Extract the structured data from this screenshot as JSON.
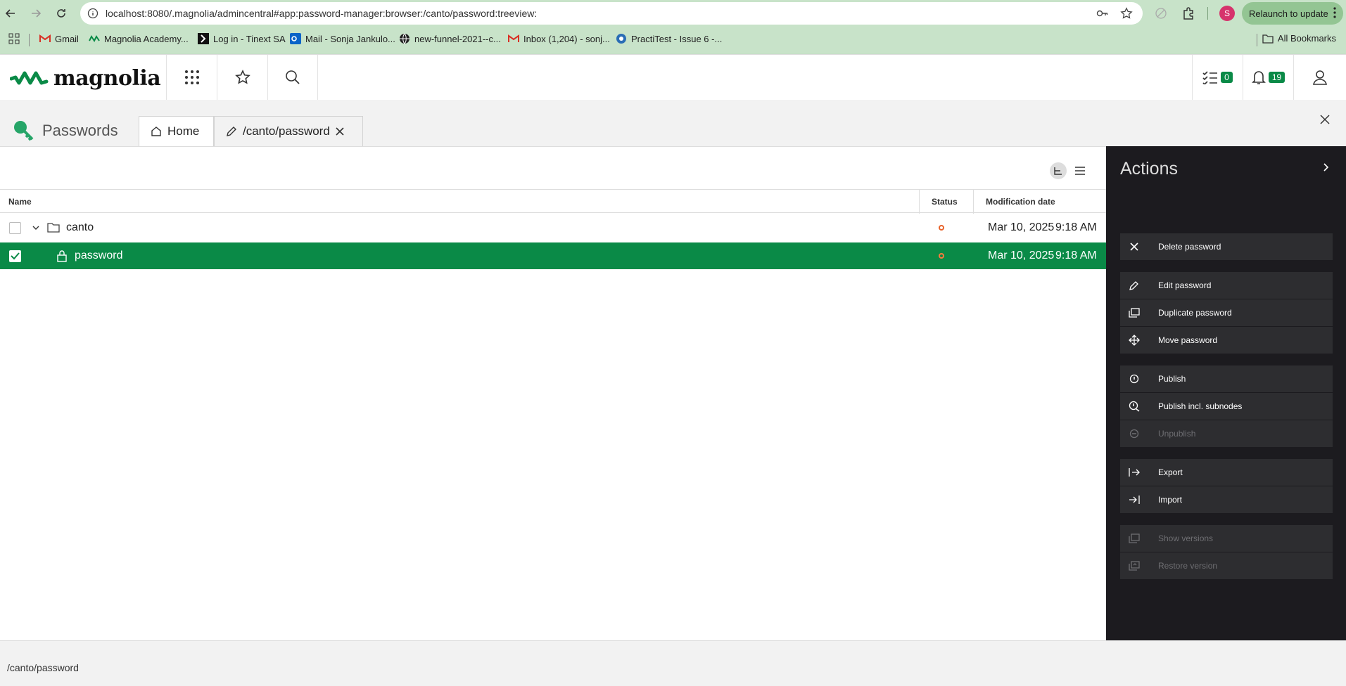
{
  "browser": {
    "url_host": "localhost",
    "url_rest": ":8080/.magnolia/admincentral#app:password-manager:browser:/canto/password:treeview:",
    "profile_initial": "S",
    "relaunch_label": "Relaunch to update",
    "bookmarks": [
      {
        "label": "Gmail",
        "icon": "gmail-icon"
      },
      {
        "label": "Magnolia Academy...",
        "icon": "magnolia-icon"
      },
      {
        "label": "Log in - Tinext SA",
        "icon": "tinext-icon"
      },
      {
        "label": "Mail - Sonja Jankulo...",
        "icon": "outlook-icon"
      },
      {
        "label": "new-funnel-2021--c...",
        "icon": "globe-icon"
      },
      {
        "label": "Inbox (1,204) - sonj...",
        "icon": "gmail-icon"
      },
      {
        "label": "PractiTest - Issue 6 -...",
        "icon": "practitest-icon"
      }
    ],
    "all_bookmarks_label": "All Bookmarks"
  },
  "header": {
    "logo_text": "magnolia",
    "tasks_count": "0",
    "notifications_count": "19"
  },
  "app": {
    "title": "Passwords",
    "tabs": [
      {
        "label": "Home",
        "icon": "home-icon"
      },
      {
        "label": "/canto/password",
        "icon": "pencil-icon"
      }
    ]
  },
  "grid": {
    "columns": {
      "name": "Name",
      "status": "Status",
      "modified": "Modification date"
    },
    "rows": [
      {
        "name": "canto",
        "type": "folder",
        "date": "Mar 10, 2025",
        "time": "9:18 AM",
        "selected": false
      },
      {
        "name": "password",
        "type": "password",
        "date": "Mar 10, 2025",
        "time": "9:18 AM",
        "selected": true
      }
    ]
  },
  "actions": {
    "title": "Actions",
    "items": [
      {
        "label": "Delete password",
        "icon": "close-icon",
        "enabled": true
      },
      {
        "label": "Edit password",
        "icon": "pencil-icon",
        "enabled": true
      },
      {
        "label": "Duplicate password",
        "icon": "duplicate-icon",
        "enabled": true
      },
      {
        "label": "Move password",
        "icon": "move-icon",
        "enabled": true
      },
      {
        "label": "Publish",
        "icon": "publish-icon",
        "enabled": true
      },
      {
        "label": "Publish incl. subnodes",
        "icon": "publish-subnodes-icon",
        "enabled": true
      },
      {
        "label": "Unpublish",
        "icon": "unpublish-icon",
        "enabled": false
      },
      {
        "label": "Export",
        "icon": "export-icon",
        "enabled": true
      },
      {
        "label": "Import",
        "icon": "import-icon",
        "enabled": true
      },
      {
        "label": "Show versions",
        "icon": "versions-icon",
        "enabled": false
      },
      {
        "label": "Restore version",
        "icon": "restore-version-icon",
        "enabled": false
      }
    ]
  },
  "footer": {
    "path": "/canto/password"
  },
  "colors": {
    "accent": "#0a8a47",
    "status_dot": "#e8632b",
    "actions_bg": "#1c1b1f"
  }
}
